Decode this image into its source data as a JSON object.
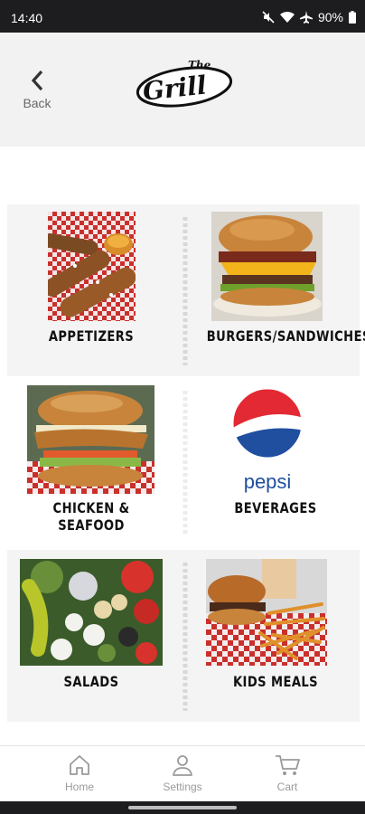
{
  "status_bar": {
    "time": "14:40",
    "battery": "90%",
    "icons": [
      "mute-icon",
      "wifi-icon",
      "airplane-icon",
      "battery-icon"
    ]
  },
  "header": {
    "back_label": "Back",
    "logo_text_top": "The",
    "logo_text_main": "Grill"
  },
  "categories": [
    {
      "label": "APPETIZERS",
      "image": "pretzel-sticks-with-cheese-photo"
    },
    {
      "label": "BURGERS/SANDWICHES",
      "image": "bacon-cheeseburger-photo"
    },
    {
      "label": "CHICKEN & SEAFOOD",
      "image": "chicken-sandwich-photo"
    },
    {
      "label": "BEVERAGES",
      "image": "pepsi-logo",
      "brand_text": "pepsi"
    },
    {
      "label": "SALADS",
      "image": "salad-photo"
    },
    {
      "label": "KIDS MEALS",
      "image": "burger-and-fries-photo"
    }
  ],
  "bottom_nav": [
    {
      "label": "Home",
      "icon": "home-icon"
    },
    {
      "label": "Settings",
      "icon": "person-icon"
    },
    {
      "label": "Cart",
      "icon": "cart-icon"
    }
  ],
  "colors": {
    "status_bar": "#1d1d1f",
    "header_bg": "#f2f2f2",
    "tile_bg": "#f4f4f4",
    "pepsi_red": "#e32934",
    "pepsi_blue": "#1f4f9e",
    "nav_gray": "#9a9a9a"
  }
}
